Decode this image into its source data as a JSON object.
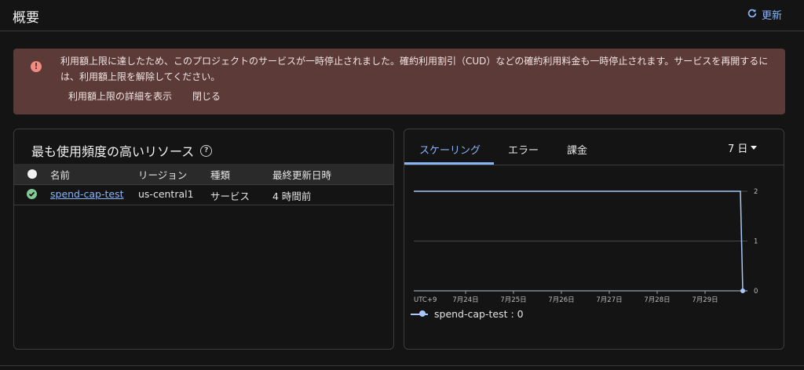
{
  "header": {
    "title": "概要",
    "refresh_label": "更新"
  },
  "banner": {
    "message": "利用額上限に達したため、このプロジェクトのサービスが一時停止されました。確約利用割引（CUD）などの確約利用料金も一時停止されます。サービスを再開するには、利用額上限を解除してください。",
    "details_label": "利用額上限の詳細を表示",
    "close_label": "閉じる"
  },
  "resources": {
    "title": "最も使用頻度の高いリソース",
    "columns": [
      "名前",
      "リージョン",
      "種類",
      "最終更新日時"
    ],
    "rows": [
      {
        "name": "spend-cap-test",
        "region": "us-central1",
        "type": "サービス",
        "updated": "4 時間前"
      }
    ]
  },
  "metrics": {
    "tabs": [
      "スケーリング",
      "エラー",
      "課金"
    ],
    "active_tab": 0,
    "range_label": "7 日"
  },
  "chart_data": {
    "type": "line",
    "timezone_label": "UTC+9",
    "x_ticks": [
      "7月24日",
      "7月25日",
      "7月26日",
      "7月27日",
      "7月28日",
      "7月29日"
    ],
    "y_ticks": [
      "0",
      "1",
      "2"
    ],
    "ylim": [
      0,
      2
    ],
    "series": [
      {
        "name": "spend-cap-test",
        "color": "#a8c7fa",
        "x": [
          0,
          6.95,
          7.0
        ],
        "y": [
          2,
          2,
          0
        ]
      }
    ],
    "legend_text": "spend-cap-test : 0"
  },
  "colors": {
    "background": "#141414",
    "banner": "#5b3a37",
    "accent": "#8ab4f8",
    "success": "#81c995",
    "error": "#f28b82"
  }
}
